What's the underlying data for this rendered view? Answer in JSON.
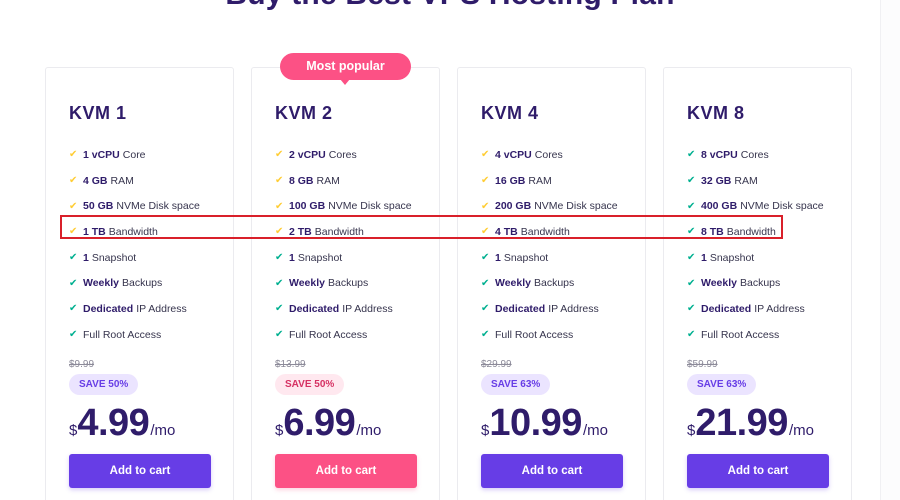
{
  "header": {
    "title": "Buy the Best VPS Hosting Plan"
  },
  "popular_badge": "Most popular",
  "colors": {
    "primary": "#673de6",
    "accent_pink": "#fc5185",
    "check_gold": "#ffcd35",
    "check_green": "#00b090",
    "highlight": "#d9202a",
    "text_dark": "#2f1c6a"
  },
  "plans": [
    {
      "name": "KVM 1",
      "features": [
        {
          "bold": "1 vCPU",
          "text": "Core",
          "check": "gold"
        },
        {
          "bold": "4 GB",
          "text": "RAM",
          "check": "gold"
        },
        {
          "bold": "50 GB",
          "text": "NVMe Disk space",
          "check": "gold"
        },
        {
          "bold": "1 TB",
          "text": "Bandwidth",
          "check": "gold"
        },
        {
          "bold": "1",
          "text": "Snapshot",
          "check": "green"
        },
        {
          "bold": "Weekly",
          "text": "Backups",
          "check": "green"
        },
        {
          "bold": "Dedicated",
          "text": "IP Address",
          "check": "green"
        },
        {
          "bold": "",
          "text": "Full Root Access",
          "check": "green"
        }
      ],
      "old_price": "$9.99",
      "save": "SAVE 50%",
      "currency": "$",
      "price": "4.99",
      "period": "/mo",
      "button": "Add to cart"
    },
    {
      "name": "KVM 2",
      "features": [
        {
          "bold": "2 vCPU",
          "text": "Cores",
          "check": "gold"
        },
        {
          "bold": "8 GB",
          "text": "RAM",
          "check": "gold"
        },
        {
          "bold": "100 GB",
          "text": "NVMe Disk space",
          "check": "gold"
        },
        {
          "bold": "2 TB",
          "text": "Bandwidth",
          "check": "gold"
        },
        {
          "bold": "1",
          "text": "Snapshot",
          "check": "green"
        },
        {
          "bold": "Weekly",
          "text": "Backups",
          "check": "green"
        },
        {
          "bold": "Dedicated",
          "text": "IP Address",
          "check": "green"
        },
        {
          "bold": "",
          "text": "Full Root Access",
          "check": "green"
        }
      ],
      "old_price": "$13.99",
      "save": "SAVE 50%",
      "currency": "$",
      "price": "6.99",
      "period": "/mo",
      "button": "Add to cart"
    },
    {
      "name": "KVM 4",
      "features": [
        {
          "bold": "4 vCPU",
          "text": "Cores",
          "check": "gold"
        },
        {
          "bold": "16 GB",
          "text": "RAM",
          "check": "gold"
        },
        {
          "bold": "200 GB",
          "text": "NVMe Disk space",
          "check": "gold"
        },
        {
          "bold": "4 TB",
          "text": "Bandwidth",
          "check": "gold"
        },
        {
          "bold": "1",
          "text": "Snapshot",
          "check": "green"
        },
        {
          "bold": "Weekly",
          "text": "Backups",
          "check": "green"
        },
        {
          "bold": "Dedicated",
          "text": "IP Address",
          "check": "green"
        },
        {
          "bold": "",
          "text": "Full Root Access",
          "check": "green"
        }
      ],
      "old_price": "$29.99",
      "save": "SAVE 63%",
      "currency": "$",
      "price": "10.99",
      "period": "/mo",
      "button": "Add to cart"
    },
    {
      "name": "KVM 8",
      "features": [
        {
          "bold": "8 vCPU",
          "text": "Cores",
          "check": "green"
        },
        {
          "bold": "32 GB",
          "text": "RAM",
          "check": "green"
        },
        {
          "bold": "400 GB",
          "text": "NVMe Disk space",
          "check": "green"
        },
        {
          "bold": "8 TB",
          "text": "Bandwidth",
          "check": "green"
        },
        {
          "bold": "1",
          "text": "Snapshot",
          "check": "green"
        },
        {
          "bold": "Weekly",
          "text": "Backups",
          "check": "green"
        },
        {
          "bold": "Dedicated",
          "text": "IP Address",
          "check": "green"
        },
        {
          "bold": "",
          "text": "Full Root Access",
          "check": "green"
        }
      ],
      "old_price": "$59.99",
      "save": "SAVE 63%",
      "currency": "$",
      "price": "21.99",
      "period": "/mo",
      "button": "Add to cart"
    }
  ]
}
